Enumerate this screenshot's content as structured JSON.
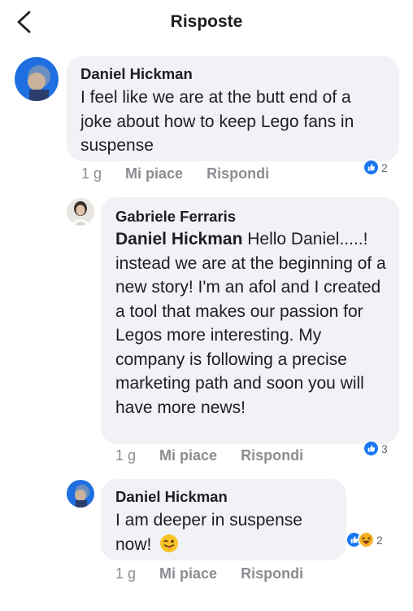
{
  "header": {
    "title": "Risposte"
  },
  "comments": [
    {
      "author": "Daniel Hickman",
      "text": "I feel like we are at the butt end of a joke about how to keep Lego fans in suspense",
      "time": "1 g",
      "like_label": "Mi piace",
      "reply_label": "Rispondi",
      "reaction_count": "2",
      "reaction_icons": [
        "like-icon"
      ]
    },
    {
      "author": "Gabriele Ferraris",
      "mention": "Daniel Hickman",
      "text": " Hello Daniel.....! instead we are at the beginning of a new story!  I'm an afol and I created a tool that makes our passion for Legos more interesting.  My company is following a precise marketing path and soon you will have more news!",
      "time": "1 g",
      "like_label": "Mi piace",
      "reply_label": "Rispondi",
      "reaction_count": "3",
      "reaction_icons": [
        "like-icon"
      ]
    },
    {
      "author": "Daniel Hickman",
      "text": "I am deeper in suspense now!",
      "emoji": "winking-tongue-emoji",
      "time": "1 g",
      "like_label": "Mi piace",
      "reply_label": "Rispondi",
      "reaction_count": "2",
      "reaction_icons": [
        "like-icon",
        "haha-icon"
      ]
    }
  ],
  "colors": {
    "like_blue": "#1877f2",
    "haha_yellow": "#f7b125",
    "bubble_bg": "#f0f2f5",
    "meta_gray": "#8a8d91"
  }
}
